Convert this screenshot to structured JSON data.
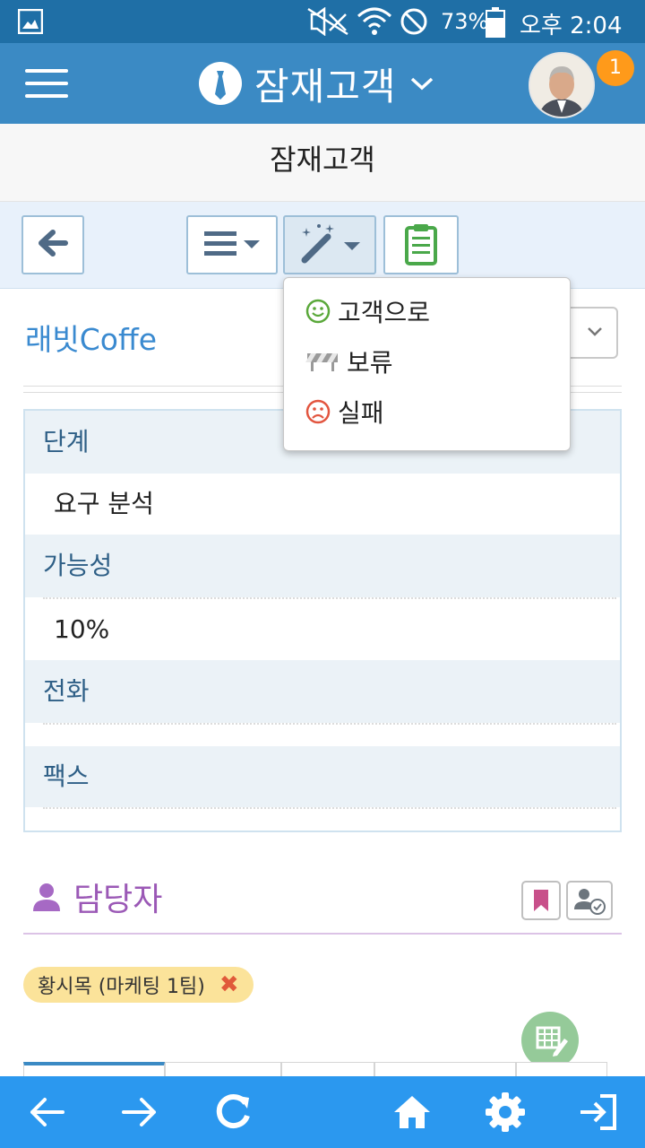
{
  "status_bar": {
    "battery": "73%",
    "time": "오후 2:04",
    "icons": [
      "gallery-icon",
      "mute-icon",
      "wifi-icon",
      "no-disturb-icon",
      "battery-icon"
    ]
  },
  "header": {
    "title": "잠재고객",
    "badge_count": "1",
    "icons": [
      "hamburger-icon",
      "tie-icon",
      "chevron-down-icon",
      "avatar"
    ]
  },
  "page": {
    "title": "잠재고객"
  },
  "toolbar": {
    "buttons": [
      "back-button",
      "list-menu-button",
      "magic-wand-button",
      "clipboard-button"
    ]
  },
  "dropdown_menu": {
    "items": [
      {
        "label": "고객으로",
        "icon": "smile-icon",
        "icon_color": "#5aa83a"
      },
      {
        "label": "보류",
        "icon": "barrier-icon",
        "icon_color": "#9a9a9a"
      },
      {
        "label": "실패",
        "icon": "frown-icon",
        "icon_color": "#e2553f"
      }
    ]
  },
  "record": {
    "company": "래빗Coffe",
    "fields": [
      {
        "label": "단계",
        "value": "요구 분석"
      },
      {
        "label": "가능성",
        "value": "10%"
      },
      {
        "label": "전화",
        "value": ""
      },
      {
        "label": "팩스",
        "value": ""
      }
    ]
  },
  "owner_section": {
    "title": "담당자",
    "tag": "황시목 (마케팅 1팀)"
  },
  "bottom_nav": {
    "icons": [
      "arrow-left-icon",
      "arrow-right-icon",
      "refresh-icon",
      "home-icon",
      "gear-icon",
      "exit-icon"
    ]
  },
  "colors": {
    "status_bar": "#1f6fa6",
    "app_bar": "#3b8ac4",
    "bottom_bar": "#2b98ef",
    "accent_purple": "#9b59b6",
    "company_blue": "#3a8ad0",
    "badge": "#ff9a1a"
  }
}
